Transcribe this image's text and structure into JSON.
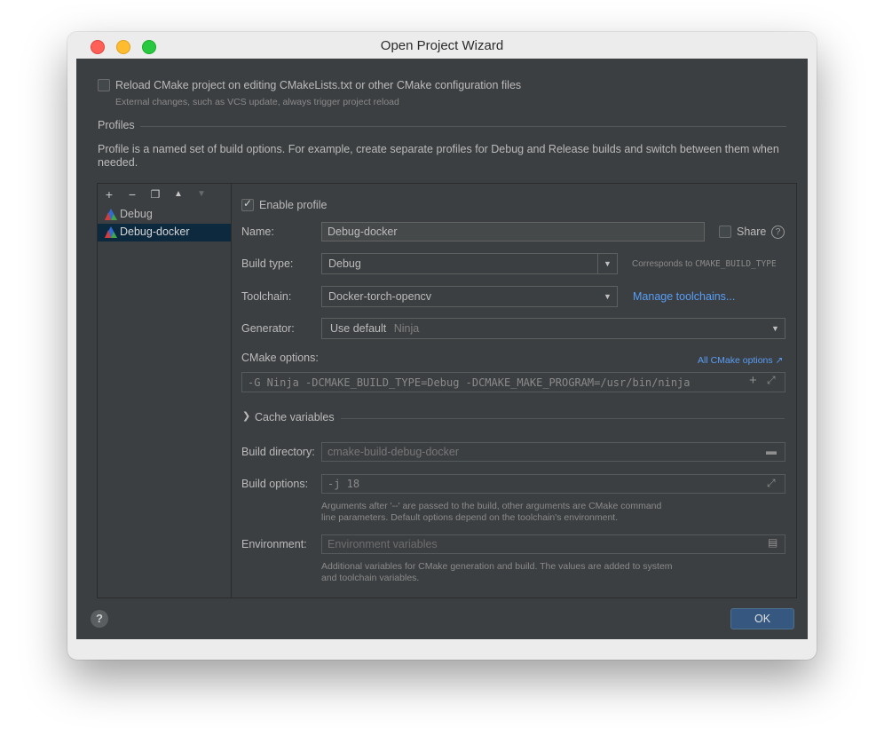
{
  "window": {
    "title": "Open Project Wizard"
  },
  "reload": {
    "checked": false,
    "label": "Reload CMake project on editing CMakeLists.txt or other CMake configuration files",
    "hint": "External changes, such as VCS update, always trigger project reload"
  },
  "profiles": {
    "section_title": "Profiles",
    "description_line1": "Profile is a named set of build options. For example, create separate profiles for Debug and Release builds and switch between them when",
    "description_line2": "needed.",
    "toolbar": [
      "add-icon",
      "remove-icon",
      "copy-icon",
      "move-up-icon",
      "move-down-icon"
    ],
    "items": [
      {
        "label": "Debug",
        "selected": false
      },
      {
        "label": "Debug-docker",
        "selected": true
      }
    ]
  },
  "form": {
    "enable_profile_label": "Enable profile",
    "enable_profile_checked": true,
    "name_label": "Name:",
    "name_value": "Debug-docker",
    "share_label": "Share",
    "build_type_label": "Build type:",
    "build_type_value": "Debug",
    "build_type_hint_prefix": "Corresponds to ",
    "build_type_hint_code": "CMAKE_BUILD_TYPE",
    "toolchain_label": "Toolchain:",
    "toolchain_value": "Docker-torch-opencv",
    "manage_toolchains": "Manage toolchains...",
    "generator_label": "Generator:",
    "generator_value": "Use default",
    "generator_hint": "Ninja",
    "cmake_options_label": "CMake options:",
    "all_cmake_options": "All CMake options ↗",
    "cmake_options_value": "-G Ninja -DCMAKE_BUILD_TYPE=Debug -DCMAKE_MAKE_PROGRAM=/usr/bin/ninja",
    "cache_variables_label": "Cache variables",
    "build_directory_label": "Build directory:",
    "build_directory_value": "cmake-build-debug-docker",
    "build_options_label": "Build options:",
    "build_options_value": "-j 18",
    "build_options_hint1": "Arguments after '--' are passed to the build, other arguments are CMake command",
    "build_options_hint2": "line parameters. Default options depend on the toolchain's environment.",
    "environment_label": "Environment:",
    "environment_placeholder": "Environment variables",
    "environment_hint1": "Additional variables for CMake generation and build. The values are added to system",
    "environment_hint2": "and toolchain variables."
  },
  "footer": {
    "ok_label": "OK"
  },
  "colors": {
    "accent": "#365880",
    "link": "#589df6",
    "selection": "#0d293e",
    "background": "#3c3f41"
  }
}
